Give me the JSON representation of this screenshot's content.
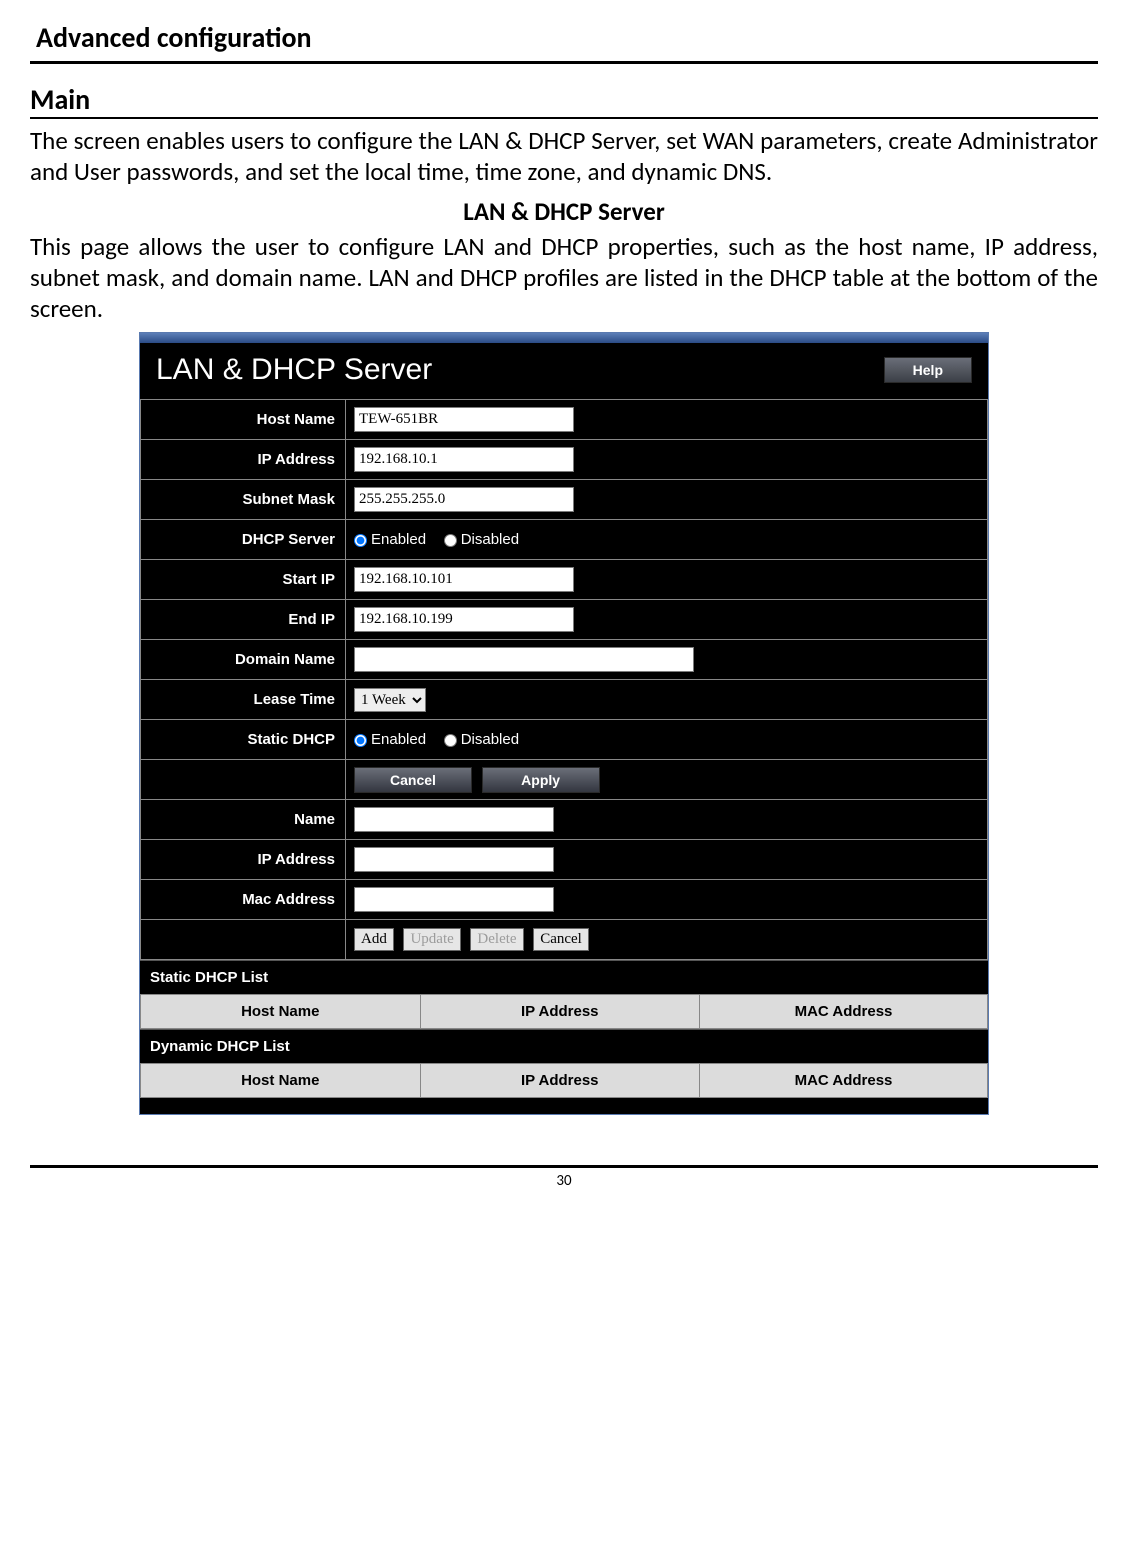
{
  "doc": {
    "title": "Advanced configuration",
    "section": "Main",
    "para1": "The screen enables users to configure the LAN & DHCP Server, set WAN parameters, create Administrator and User passwords, and set the local time, time zone, and dynamic DNS.",
    "subheading": "LAN & DHCP Server",
    "para2": "This page allows the user to configure LAN and DHCP properties, such as the host name, IP address, subnet mask, and domain name. LAN and DHCP profiles are listed in the DHCP table at the bottom of the screen.",
    "page_number": "30"
  },
  "ui": {
    "panel_title": "LAN & DHCP Server",
    "help_btn": "Help",
    "labels": {
      "host_name": "Host Name",
      "ip_address": "IP Address",
      "subnet_mask": "Subnet Mask",
      "dhcp_server": "DHCP Server",
      "start_ip": "Start IP",
      "end_ip": "End IP",
      "domain_name": "Domain Name",
      "lease_time": "Lease Time",
      "static_dhcp": "Static DHCP",
      "name": "Name",
      "ip_address2": "IP Address",
      "mac_address": "Mac Address"
    },
    "values": {
      "host_name": "TEW-651BR",
      "ip_address": "192.168.10.1",
      "subnet_mask": "255.255.255.0",
      "start_ip": "192.168.10.101",
      "end_ip": "192.168.10.199",
      "domain_name": "",
      "lease_time": "1 Week",
      "name": "",
      "ip_address2": "",
      "mac_address": ""
    },
    "radios": {
      "enabled": "Enabled",
      "disabled": "Disabled"
    },
    "buttons": {
      "cancel": "Cancel",
      "apply": "Apply",
      "add": "Add",
      "update": "Update",
      "delete": "Delete",
      "cancel2": "Cancel"
    },
    "lists": {
      "static_title": "Static DHCP List",
      "dynamic_title": "Dynamic DHCP List",
      "cols": {
        "host": "Host Name",
        "ip": "IP Address",
        "mac": "MAC Address"
      }
    }
  }
}
